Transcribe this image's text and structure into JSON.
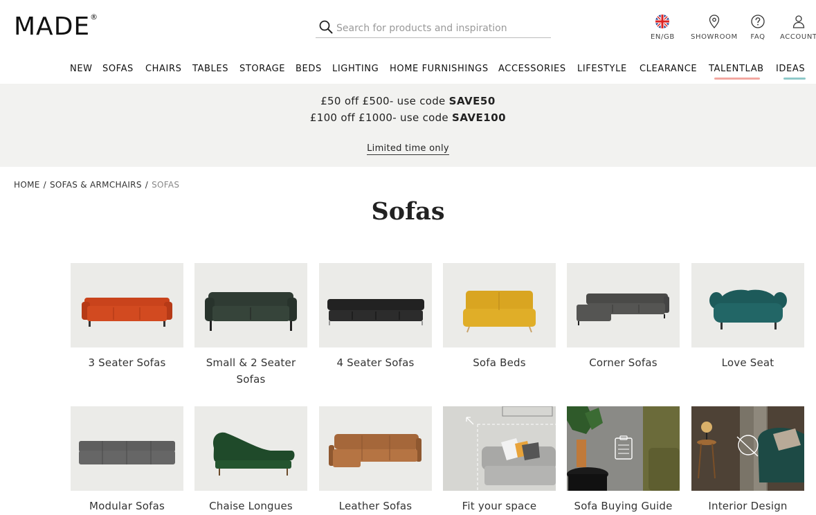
{
  "brand": {
    "logo_text": "MADE",
    "logo_mark": "®"
  },
  "search": {
    "placeholder": "Search for products and inspiration"
  },
  "utility": {
    "language": "EN/GB",
    "showroom": "SHOWROOM",
    "faq": "FAQ",
    "account": "ACCOUNT"
  },
  "nav": {
    "items": [
      "NEW",
      "SOFAS",
      "CHAIRS",
      "TABLES",
      "STORAGE",
      "BEDS",
      "LIGHTING",
      "HOME FURNISHINGS",
      "ACCESSORIES",
      "LIFESTYLE",
      "CLEARANCE",
      "TALENTLAB",
      "IDEAS"
    ]
  },
  "promo": {
    "line1_prefix": "£50 off £500- use code ",
    "line1_code": "SAVE50",
    "line2_prefix": "£100 off £1000- use code ",
    "line2_code": "SAVE100",
    "note": "Limited time only"
  },
  "breadcrumb": {
    "items": [
      "HOME",
      "SOFAS & ARMCHAIRS",
      "SOFAS"
    ],
    "separator": "/"
  },
  "page": {
    "title": "Sofas"
  },
  "categories": [
    {
      "label": "3 Seater Sofas",
      "color": "#c9431c"
    },
    {
      "label": "Small & 2 Seater Sofas",
      "color": "#2f3b33"
    },
    {
      "label": "4 Seater Sofas",
      "color": "#222222"
    },
    {
      "label": "Sofa Beds",
      "color": "#d9a521"
    },
    {
      "label": "Corner Sofas",
      "color": "#4a4a48"
    },
    {
      "label": "Love Seat",
      "color": "#1d5a5a"
    },
    {
      "label": "Modular Sofas",
      "color": "#5e5e5e"
    },
    {
      "label": "Chaise Longues",
      "color": "#1f4a2a"
    },
    {
      "label": "Leather Sofas",
      "color": "#a5673a"
    },
    {
      "label": "Fit your space",
      "color": "#9e9e9e"
    },
    {
      "label": "Sofa Buying Guide",
      "color": "#6b6b3a"
    },
    {
      "label": "Interior Design",
      "color": "#1d4a45"
    }
  ],
  "colors": {
    "talentlab_underline": "#f2a7a0",
    "ideas_underline": "#8ec9c9",
    "promo_bg": "#f2f2f0",
    "thumb_bg": "#ebebe8"
  }
}
